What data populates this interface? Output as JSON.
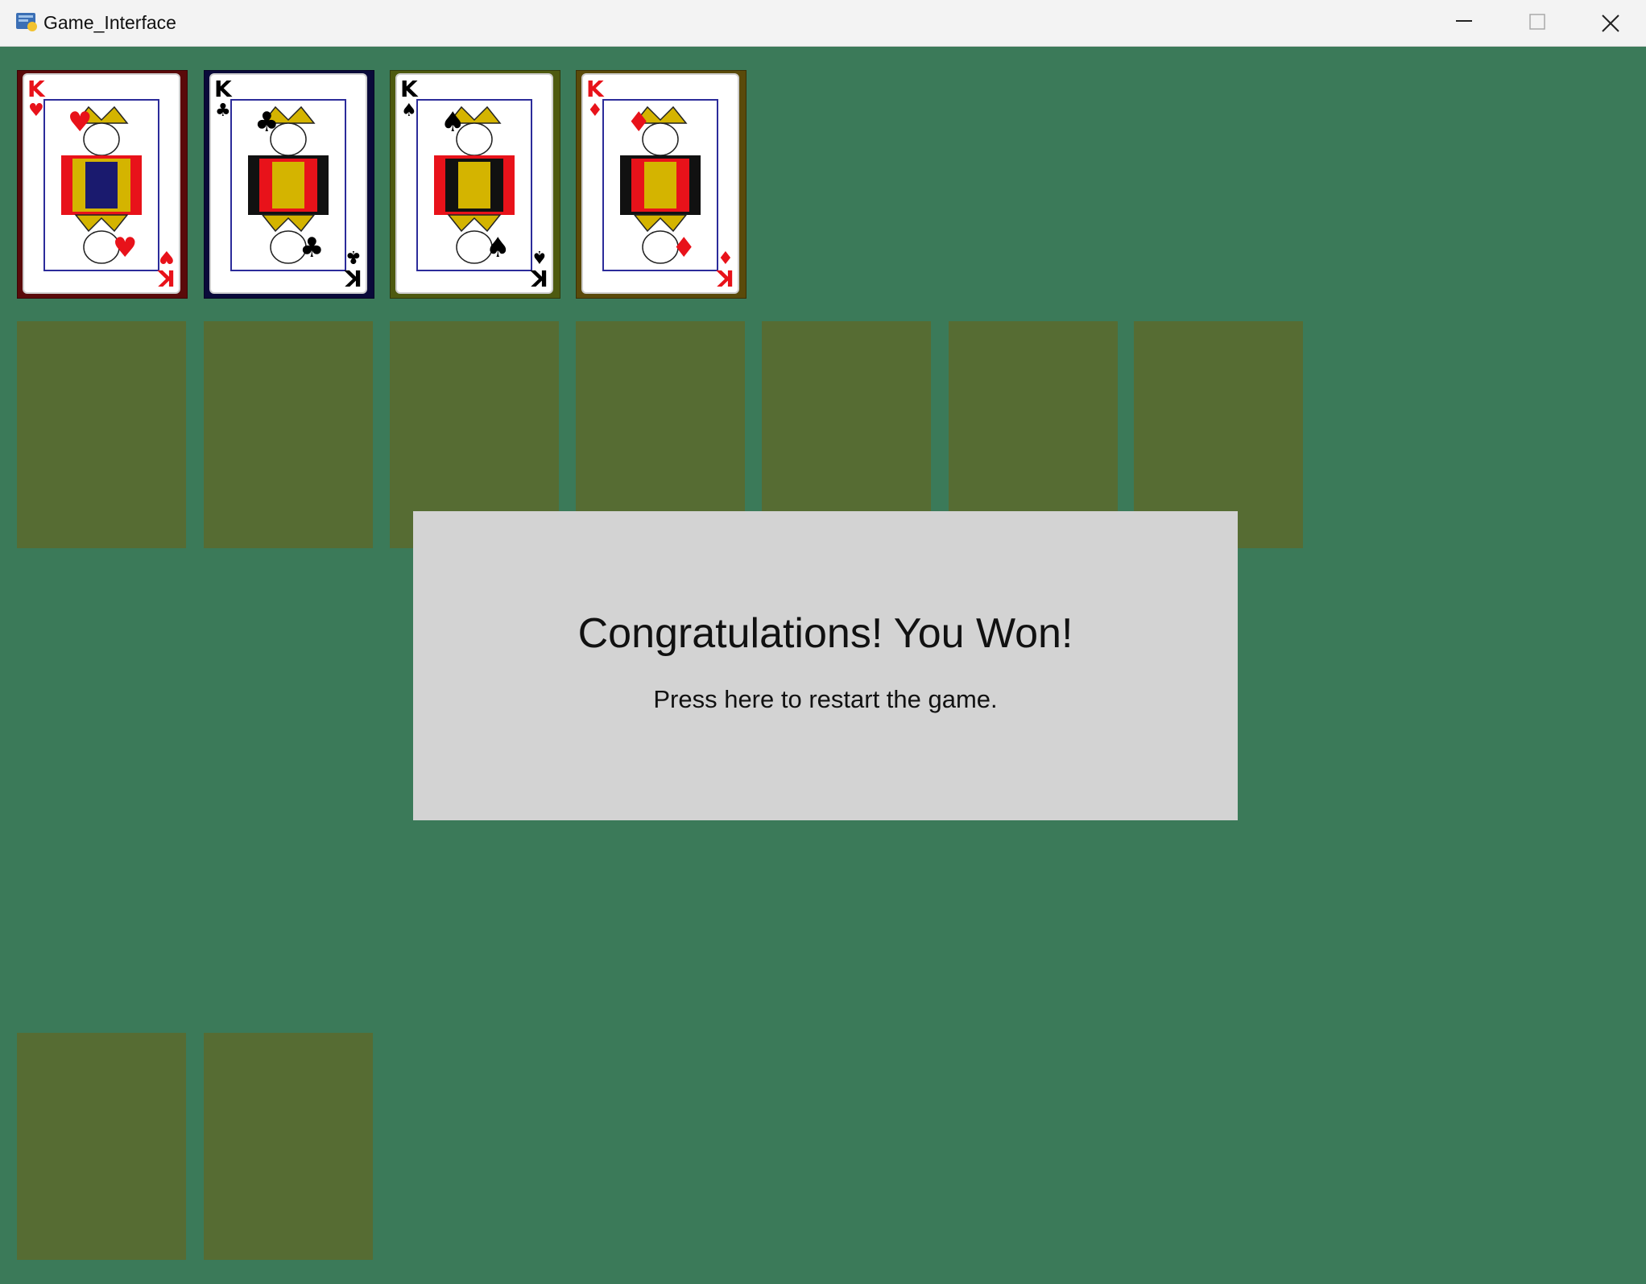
{
  "window": {
    "title": "Game_Interface",
    "minimize_icon": "minimize-icon",
    "maximize_icon": "maximize-icon",
    "close_icon": "close-icon"
  },
  "colors": {
    "table": "#3b7a59",
    "empty_slot": "#566c33",
    "dialog": "#d3d3d3",
    "red_suit": "#e8121a",
    "black_suit": "#000000"
  },
  "foundations": [
    {
      "rank": "K",
      "suit": "♥",
      "suit_name": "hearts",
      "color": "#e8121a"
    },
    {
      "rank": "K",
      "suit": "♣",
      "suit_name": "clubs",
      "color": "#000000"
    },
    {
      "rank": "K",
      "suit": "♠",
      "suit_name": "spades",
      "color": "#000000"
    },
    {
      "rank": "K",
      "suit": "♦",
      "suit_name": "diamonds",
      "color": "#e8121a"
    }
  ],
  "tableau_slots": 7,
  "bottom_slots": 2,
  "dialog": {
    "title": "Congratulations! You Won!",
    "subtitle": "Press here to restart the game."
  }
}
